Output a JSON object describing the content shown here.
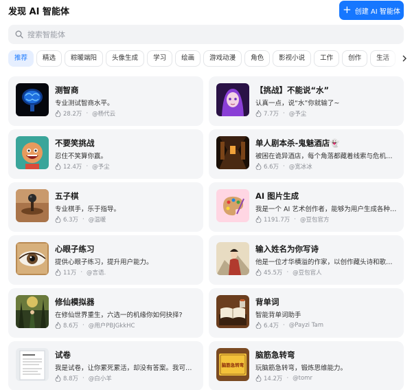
{
  "header": {
    "title": "发现 AI 智能体",
    "create_label": "创建 AI 智能体"
  },
  "search": {
    "placeholder": "搜索智能体"
  },
  "tabs": [
    "推荐",
    "精选",
    "粽暖端阳",
    "头像生成",
    "学习",
    "绘画",
    "游戏动漫",
    "角色",
    "影视小说",
    "工作",
    "创作",
    "生活"
  ],
  "active_tab": "推荐",
  "cards": [
    {
      "name": "测智商",
      "desc": "专业测试智商水平。",
      "count": "28.2万",
      "author": "@杨代云",
      "icon": "brain-image"
    },
    {
      "name": "【挑战】不能说“水”",
      "desc": "认真一点，说“水”你就输了~",
      "count": "7.7万",
      "author": "@予尘",
      "icon": "anime-girl-image"
    },
    {
      "name": "不要笑挑战",
      "desc": "忍住不笑算你赢。",
      "count": "12.4万",
      "author": "@予尘",
      "icon": "cartoon-boy-image"
    },
    {
      "name": "单人剧本杀-鬼魅酒店👻",
      "desc": "被困在诡异酒店，每个角落都藏着线索与危机。你能找到真相逃出去吗？",
      "count": "6.6万",
      "author": "@宽冰冰",
      "icon": "hotel-hallway-image"
    },
    {
      "name": "五子棋",
      "desc": "专业棋手，乐于指导。",
      "count": "6.3万",
      "author": "@温暖",
      "icon": "gomoku-image"
    },
    {
      "name": "AI 图片生成",
      "desc": "我是一个 AI 艺术创作者，能够为用户生成各种风格的图片。",
      "count": "1191.7万",
      "author": "@豆包官方",
      "icon": "palette-image"
    },
    {
      "name": "心眼子练习",
      "desc": "提供心眼子练习，提升用户能力。",
      "count": "11万",
      "author": "@言语.",
      "icon": "eye-image"
    },
    {
      "name": "输入姓名为你写诗",
      "desc": "他是一位才华横溢的作家，以创作藏头诗和歌曲为主。",
      "count": "45.5万",
      "author": "@豆包官人",
      "icon": "poet-painting-image"
    },
    {
      "name": "修仙模拟器",
      "desc": "在修仙世界重生，六选一的机缘你如何抉择?",
      "count": "8.6万",
      "author": "@用户PBJGkkHC",
      "icon": "cultivation-image"
    },
    {
      "name": "背单词",
      "desc": "智能背单词助手",
      "count": "6.4万",
      "author": "@Payzi Tam",
      "icon": "book-image"
    },
    {
      "name": "试卷",
      "desc": "我是试卷，让你累死累活，却没有答案。我可以给你出题。",
      "count": "8.8万",
      "author": "@白小羊",
      "icon": "exam-paper-image"
    },
    {
      "name": "脑筋急转弯",
      "desc": "玩脑筋急转弯，锻炼思维能力。",
      "count": "14.2万",
      "author": "@tomr",
      "icon": "riddle-sign-image"
    }
  ],
  "thumb_text": {
    "riddle_sign": "脑筋急转弯"
  },
  "colors": {
    "accent": "#1677ff",
    "card_bg": "#f4f5f7",
    "tab_active_bg": "#e6efff"
  }
}
